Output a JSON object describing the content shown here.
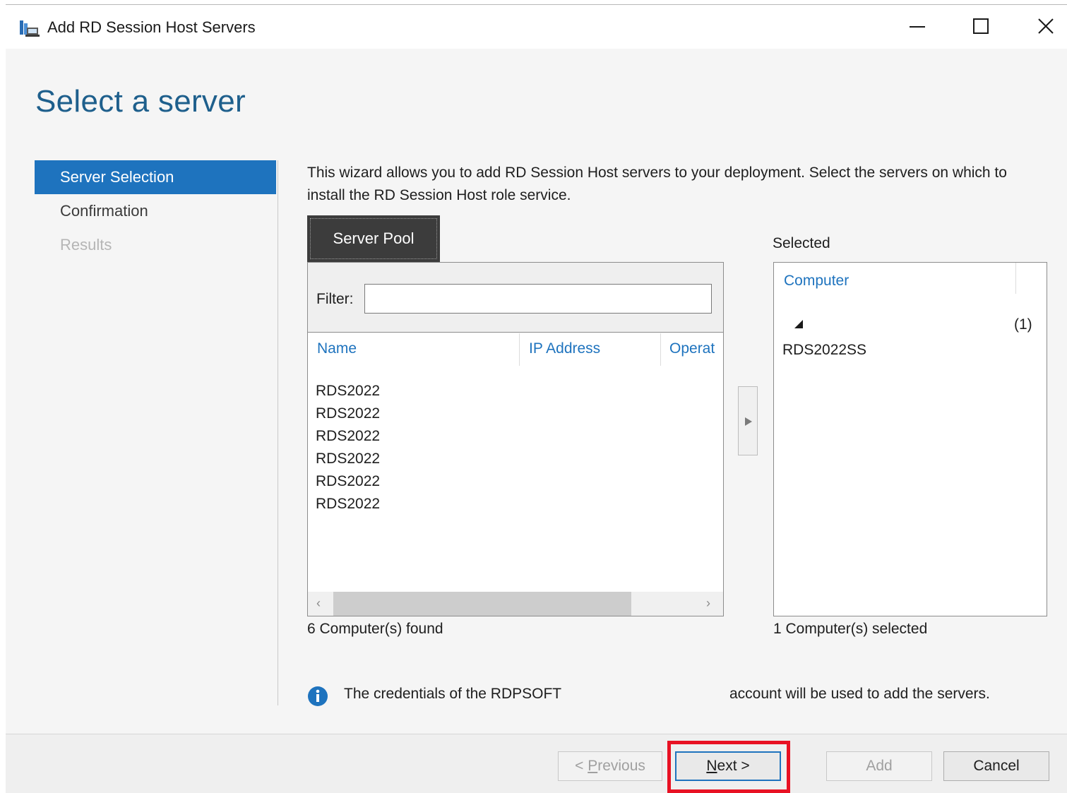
{
  "window": {
    "title": "Add RD Session Host Servers",
    "controls": {
      "minimize": "minimize-icon",
      "maximize": "maximize-icon",
      "close": "close-icon"
    }
  },
  "page": {
    "title": "Select a server"
  },
  "nav": {
    "items": [
      {
        "label": "Server Selection",
        "state": "active"
      },
      {
        "label": "Confirmation",
        "state": "enabled"
      },
      {
        "label": "Results",
        "state": "disabled"
      }
    ]
  },
  "description": "This wizard allows you to add RD Session Host servers to your deployment. Select the servers on which to install the RD Session Host role service.",
  "server_pool": {
    "tab_label": "Server Pool",
    "filter_label": "Filter:",
    "filter_value": "",
    "columns": [
      "Name",
      "IP Address",
      "Operat"
    ],
    "rows": [
      "RDS2022",
      "RDS2022",
      "RDS2022",
      "RDS2022",
      "RDS2022",
      "RDS2022"
    ],
    "found_text": "6 Computer(s) found"
  },
  "selected": {
    "label": "Selected",
    "column": "Computer",
    "group_count": "(1)",
    "items": [
      "RDS2022SS"
    ],
    "selected_text": "1 Computer(s) selected"
  },
  "info": {
    "icon": "info-icon",
    "text_part1": "The credentials of the RDPSOFT",
    "text_part2": "account will be used to add the servers."
  },
  "buttons": {
    "previous": {
      "prefix": "< ",
      "mnemonic": "P",
      "rest": "revious"
    },
    "next": {
      "mnemonic": "N",
      "rest": "ext >"
    },
    "add": "Add",
    "cancel": "Cancel"
  },
  "colors": {
    "accent": "#1e73be",
    "title": "#1e5f8c",
    "highlight": "#e81123"
  }
}
